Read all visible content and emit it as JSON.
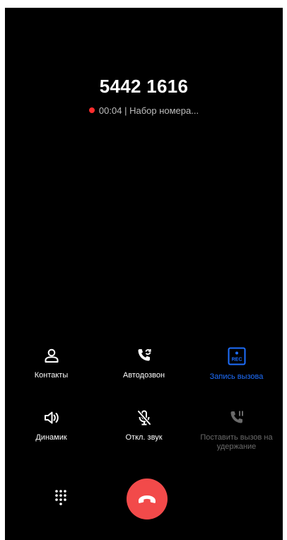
{
  "call": {
    "number": "5442 1616",
    "timer": "00:04",
    "separator": "|",
    "state": "Набор номера..."
  },
  "actions": {
    "contacts": {
      "label": "Контакты",
      "icon": "person-icon"
    },
    "redial": {
      "label": "Автодозвон",
      "icon": "auto-redial-icon"
    },
    "record": {
      "label": "Запись вызова",
      "icon": "rec-icon",
      "badge": "REC"
    },
    "speaker": {
      "label": "Динамик",
      "icon": "speaker-icon"
    },
    "mute": {
      "label": "Откл. звук",
      "icon": "mic-off-icon"
    },
    "hold": {
      "label": "Поставить вызов на удержание",
      "icon": "phone-pause-icon"
    }
  },
  "bottom": {
    "dialpad_icon": "dialpad-icon",
    "hangup_icon": "end-call-icon"
  },
  "colors": {
    "background": "#000000",
    "accent": "#1e6fff",
    "end_call": "#f24a4a",
    "recording_dot": "#ff2d2d",
    "disabled": "#6a6a6a"
  }
}
